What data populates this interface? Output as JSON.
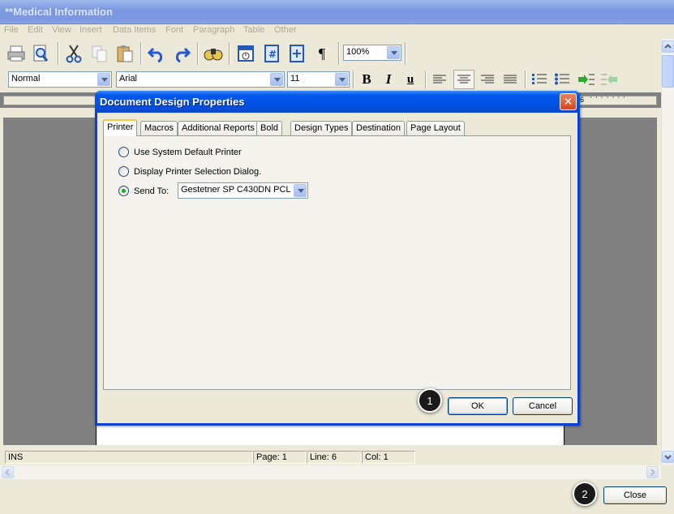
{
  "window": {
    "title": "**Medical Information"
  },
  "menu": [
    "File",
    "Edit",
    "View",
    "Insert",
    "Data Items",
    "Font",
    "Paragraph",
    "Table",
    "Other"
  ],
  "toolbar": {
    "zoom": "100%",
    "style": "Normal",
    "font": "Arial",
    "size": "11",
    "bold_label": "B",
    "italic_label": "I",
    "underline_label": "u",
    "pilcrow": "¶",
    "hash": "#"
  },
  "ruler": {
    "marker": "6"
  },
  "status": {
    "mode": "INS",
    "page": "Page: 1",
    "line": "Line: 6",
    "col": "Col: 1"
  },
  "dialog": {
    "title": "Document Design Properties",
    "tabs": [
      "Printer",
      "Macros",
      "Additional Reports",
      "Bold",
      "Design Types",
      "Destination",
      "Page Layout"
    ],
    "active_tab": "Printer",
    "options": [
      {
        "label": "Use System Default Printer",
        "selected": false
      },
      {
        "label": "Display Printer Selection Dialog.",
        "selected": false
      },
      {
        "label": "Send To:",
        "selected": true
      }
    ],
    "printer_value": "Gestetner SP C430DN PCL",
    "ok_label": "OK",
    "cancel_label": "Cancel"
  },
  "close_label": "Close",
  "badges": {
    "one": "1",
    "two": "2"
  }
}
